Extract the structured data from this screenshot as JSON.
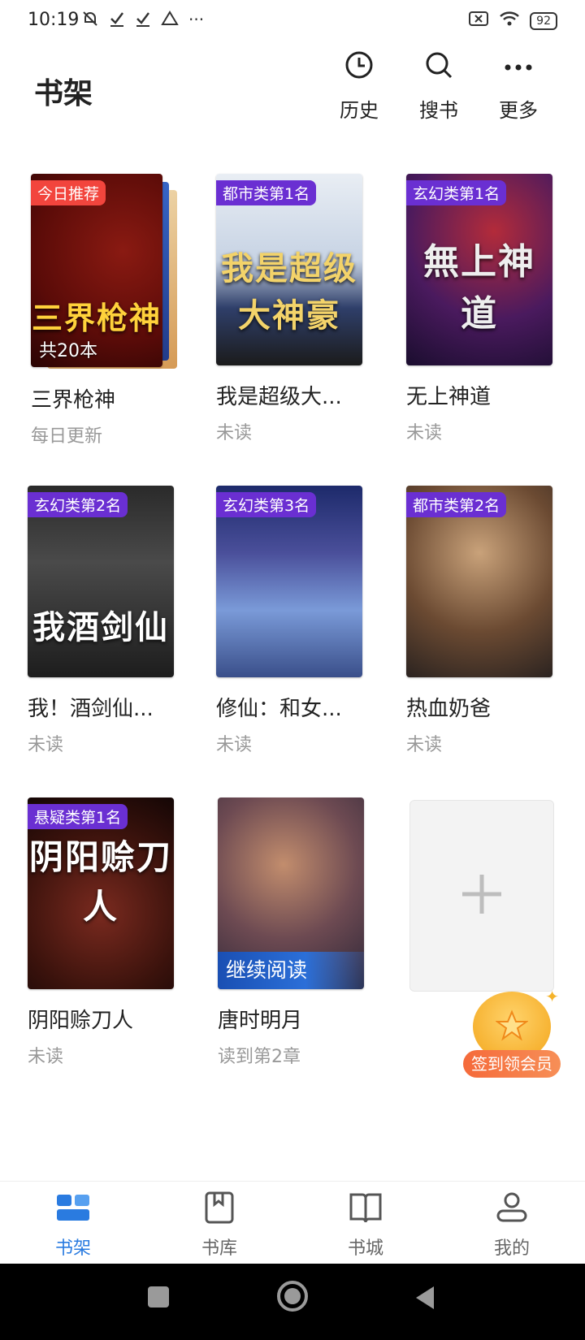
{
  "status_bar": {
    "time": "10:19",
    "left_icons": [
      "mute-icon",
      "check-icon",
      "check-icon",
      "drive-icon"
    ],
    "more": "···",
    "battery": "92"
  },
  "header": {
    "title": "书架",
    "actions": [
      {
        "label": "历史",
        "icon": "clock-icon"
      },
      {
        "label": "搜书",
        "icon": "search-icon"
      },
      {
        "label": "更多",
        "icon": "more-icon"
      }
    ]
  },
  "books": [
    {
      "badge": "今日推荐",
      "badge_color": "#f2453d",
      "title": "三界枪神",
      "status": "每日更新",
      "count_tag": "共20本",
      "art_text": "三界枪神"
    },
    {
      "badge": "都市类第1名",
      "badge_color": "#6a2fd2",
      "title": "我是超级大...",
      "status": "未读",
      "art_text": "我是超级大神豪"
    },
    {
      "badge": "玄幻类第1名",
      "badge_color": "#6a2fd2",
      "title": "无上神道",
      "status": "未读",
      "art_text": "無上神道"
    },
    {
      "badge": "玄幻类第2名",
      "badge_color": "#6a2fd2",
      "title": "我！酒剑仙...",
      "status": "未读",
      "art_text": "我酒剑仙"
    },
    {
      "badge": "玄幻类第3名",
      "badge_color": "#6a2fd2",
      "title": "修仙：和女...",
      "status": "未读",
      "art_text": ""
    },
    {
      "badge": "都市类第2名",
      "badge_color": "#6a2fd2",
      "title": "热血奶爸",
      "status": "未读",
      "art_text": ""
    },
    {
      "badge": "悬疑类第1名",
      "badge_color": "#6a2fd2",
      "title": "阴阳赊刀人",
      "status": "未读",
      "art_text": "阴阳赊刀人"
    },
    {
      "badge": "",
      "title": "唐时明月",
      "status": "读到第2章",
      "continue": "继续阅读",
      "art_text": ""
    }
  ],
  "signin": {
    "label": "签到领会员"
  },
  "tabs": [
    {
      "label": "书架",
      "icon": "bookshelf-icon",
      "active": true
    },
    {
      "label": "书库",
      "icon": "library-icon",
      "active": false
    },
    {
      "label": "书城",
      "icon": "bookstore-icon",
      "active": false
    },
    {
      "label": "我的",
      "icon": "profile-icon",
      "active": false
    }
  ],
  "colors": {
    "accent": "#2a7be0",
    "rank_badge": "#6a2fd2",
    "promo_badge": "#f2453d"
  }
}
